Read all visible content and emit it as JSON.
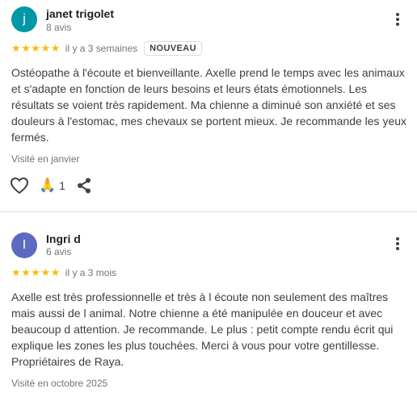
{
  "reviews": [
    {
      "avatar_letter": "j",
      "avatar_color": "#0097a7",
      "name": "janet trigolet",
      "review_count": "8 avis",
      "stars": "★★★★★",
      "time": "il y a 3 semaines",
      "badge": "NOUVEAU",
      "text": "Ostéopathe à l'écoute et bienveillante. Axelle prend le temps avec les animaux et s'adapte en fonction de leurs besoins et leurs états émotionnels. Les résultats se voient très rapidement. Ma chienne a diminué son anxiété et ses douleurs à l'estomac, mes chevaux se portent mieux. Je recommande les yeux fermés.",
      "visited": "Visité en janvier",
      "reaction_emoji": "🙏",
      "reaction_count": "1"
    },
    {
      "avatar_letter": "I",
      "avatar_color": "#5c6bc0",
      "name": "Ingri d",
      "review_count": "6 avis",
      "stars": "★★★★★",
      "time": "il y a 3 mois",
      "text": "Axelle est très professionnelle et très à l écoute non seulement des maîtres mais aussi de l animal. Notre chienne a été manipulée en douceur et avec beaucoup d attention. Je recommande. Le plus : petit compte rendu écrit qui explique les zones les plus touchées. Merci à vous pour votre gentillesse. Propriétaires de Raya.",
      "visited": "Visité en octobre 2025"
    }
  ]
}
